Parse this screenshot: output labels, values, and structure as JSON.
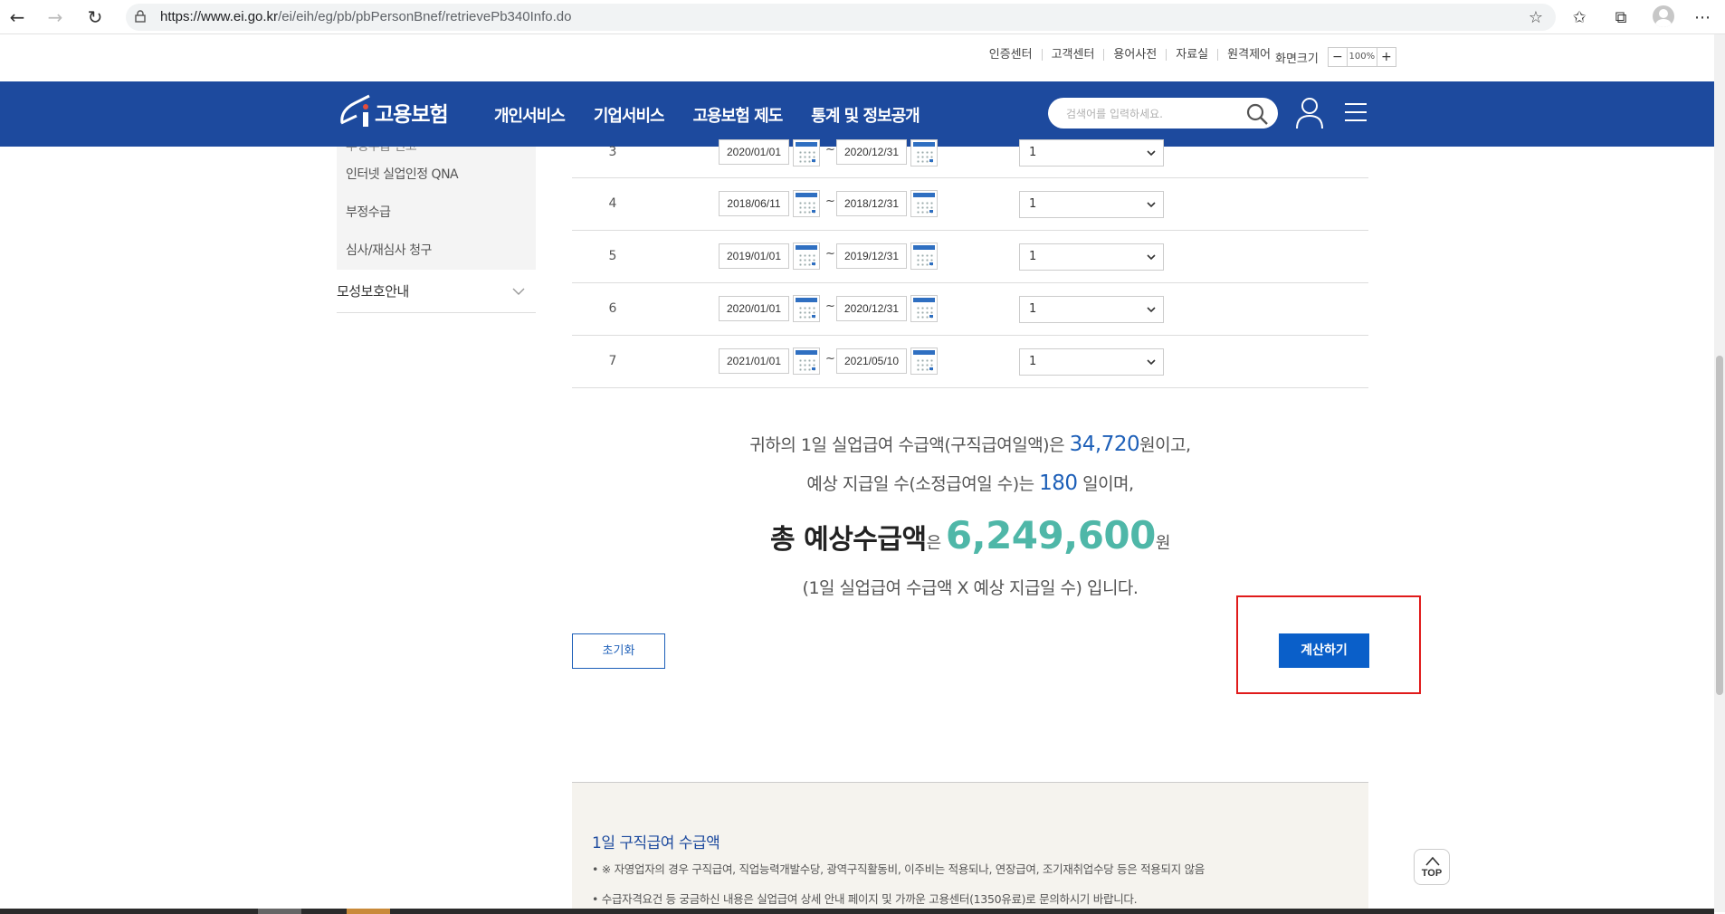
{
  "browser": {
    "url_host": "https://www.ei.go.kr",
    "url_path": "/ei/eih/eg/pb/pbPersonBnef/retrievePb340Info.do"
  },
  "utility": {
    "links": [
      "인증센터",
      "고객센터",
      "용어사전",
      "자료실",
      "원격제어"
    ],
    "zoom_label": "화면크기",
    "zoom_minus": "−",
    "zoom_value": "100%",
    "zoom_plus": "+"
  },
  "header": {
    "logo_text": "고용보험",
    "menu": [
      "개인서비스",
      "기업서비스",
      "고용보험 제도",
      "통계 및 정보공개"
    ],
    "search_placeholder": "검색어를 입력하세요."
  },
  "lnb": {
    "cut_item": "부정수급 신고",
    "items": [
      "인터넷 실업인정 QNA",
      "부정수급",
      "심사/재심사 청구"
    ],
    "main_item": "모성보호안내"
  },
  "rows": [
    {
      "no": "3",
      "from": "2020/01/01",
      "to": "2020/12/31",
      "select": "1"
    },
    {
      "no": "4",
      "from": "2018/06/11",
      "to": "2018/12/31",
      "select": "1"
    },
    {
      "no": "5",
      "from": "2019/01/01",
      "to": "2019/12/31",
      "select": "1"
    },
    {
      "no": "6",
      "from": "2020/01/01",
      "to": "2020/12/31",
      "select": "1"
    },
    {
      "no": "7",
      "from": "2021/01/01",
      "to": "2021/05/10",
      "select": "1"
    }
  ],
  "tilde": "~",
  "result": {
    "line1_pre": "귀하의 1일 실업급여 수급액(구직급여일액)은 ",
    "daily_amount": "34,720",
    "line1_post": "원이고,",
    "line2_pre": "예상 지급일 수(소정급여일 수)는 ",
    "days": "180",
    "line2_post": " 일이며,",
    "total_lead": "총 예상수급액",
    "total_particle": "은 ",
    "total_amount": "6,249,600",
    "total_unit": "원",
    "line4": "(1일 실업급여 수급액 X 예상 지급일 수) 입니다."
  },
  "buttons": {
    "reset": "초기화",
    "calculate": "계산하기"
  },
  "info": {
    "title": "1일 구직급여 수급액",
    "line1": "• ※ 자영업자의 경우 구직급여, 직업능력개발수당, 광역구직활동비, 이주비는 적용되나, 연장급여, 조기재취업수당 등은 적용되지 않음",
    "line2": "• 수급자격요건 등 궁금하신 내용은 실업급여 상세 안내 페이지 및 가까운 고용센터(1350유료)로 문의하시기 바랍니다."
  },
  "top_button": "TOP",
  "colors": {
    "header_blue": "#1d4a9e",
    "amount_blue": "#1d5fb8",
    "total_teal": "#4fb7a8",
    "calc_button": "#0a5fc9",
    "highlight_red": "#e01b1b"
  }
}
